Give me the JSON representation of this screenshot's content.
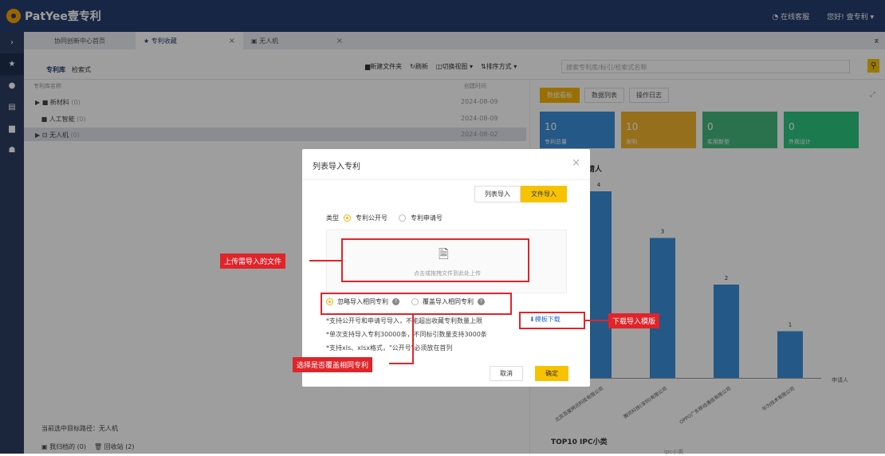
{
  "header": {
    "brand": "PatYee壹专利",
    "support": "在线客服",
    "greeting": "您好! 壹专利 ▾",
    "support_icon": "headset-icon"
  },
  "sidebar": {
    "items": [
      {
        "icon": "chevron-right-icon",
        "glyph": "›"
      },
      {
        "icon": "star-icon",
        "glyph": "★"
      },
      {
        "icon": "circle-icon",
        "glyph": "●"
      },
      {
        "icon": "grid-icon",
        "glyph": "▤"
      },
      {
        "icon": "document-icon",
        "glyph": "▆"
      },
      {
        "icon": "user-icon",
        "glyph": "☗"
      }
    ]
  },
  "tabs": [
    {
      "label": "协同创新中心首页"
    },
    {
      "label": "★ 专利收藏"
    },
    {
      "label": "▣ 无人机"
    }
  ],
  "toolbar": {
    "lib_tabs": [
      "专利库",
      "检索式"
    ],
    "tools": [
      "▆新建文件夹",
      "↻刷新",
      "◫切换视图 ▾",
      "⇅排序方式 ▾"
    ],
    "search_placeholder": "搜索专利库/标引/检索式名称"
  },
  "left": {
    "col_name": "专利库名称",
    "col_date": "创建时间",
    "rows": [
      {
        "prefix": "▶ ■ ",
        "name": "新材料",
        "count": " (0)",
        "date": "2024-08-09"
      },
      {
        "prefix": "   ■ ",
        "name": "人工智能",
        "count": " (0)",
        "date": "2024-08-09"
      },
      {
        "prefix": "▶ ⊡ ",
        "name": "无人机",
        "count": " (0)",
        "date": "2024-08-02"
      }
    ],
    "path_label": "当前选中目标路径：无人机",
    "archive": "▣ 我归档的 (0)",
    "recycle": "🗑 回收站 (2)"
  },
  "right": {
    "tabs": [
      "数据看板",
      "数据列表",
      "操作日志"
    ],
    "cards": [
      {
        "value": "10",
        "label": "专利总量",
        "color": "#3a8fd8"
      },
      {
        "value": "10",
        "label": "发明",
        "color": "#f1b32d"
      },
      {
        "value": "0",
        "label": "实用新型",
        "color": "#43b87d"
      },
      {
        "value": "0",
        "label": "外观设计",
        "color": "#2cc67f"
      }
    ],
    "chart_title_tail": "请人",
    "bottom_title": "TOP10 IPC小类",
    "bottom_sub": "ipc小类"
  },
  "chart_data": {
    "type": "bar",
    "categories": [
      "北京百度网讯科技有限公司",
      "腾讯科技(深圳)有限公司",
      "OPPO广东移动通信有限公司",
      "华为技术有限公司"
    ],
    "values": [
      4,
      3,
      2,
      1
    ],
    "xlabel": "申请人",
    "ylim": [
      0,
      4
    ],
    "color": "#3a8fd8"
  },
  "modal": {
    "title": "列表导入专利",
    "close": "×",
    "seg_list": "列表导入",
    "seg_file": "文件导入",
    "type_label": "类型",
    "opt_pub": "专利公开号",
    "opt_app": "专利申请号",
    "upload_text": "点击或拖拽文件到此处上传",
    "dup_ignore": "忽略导入相同专利",
    "dup_cover": "覆盖导入相同专利",
    "note1": "*支持公开号和申请号导入，不能超出收藏专利数量上限",
    "note2": "*单次支持导入专利30000条，不同标引数量支持3000条",
    "note3": "*支持xls、xlsx格式，\"公开号\"必须放在首列",
    "template_link": "⬇模板下载",
    "cancel": "取消",
    "ok": "确定"
  },
  "callouts": {
    "upload": "上传需导入的文件",
    "template": "下载导入模版",
    "dup": "选择是否覆盖相同专利"
  }
}
